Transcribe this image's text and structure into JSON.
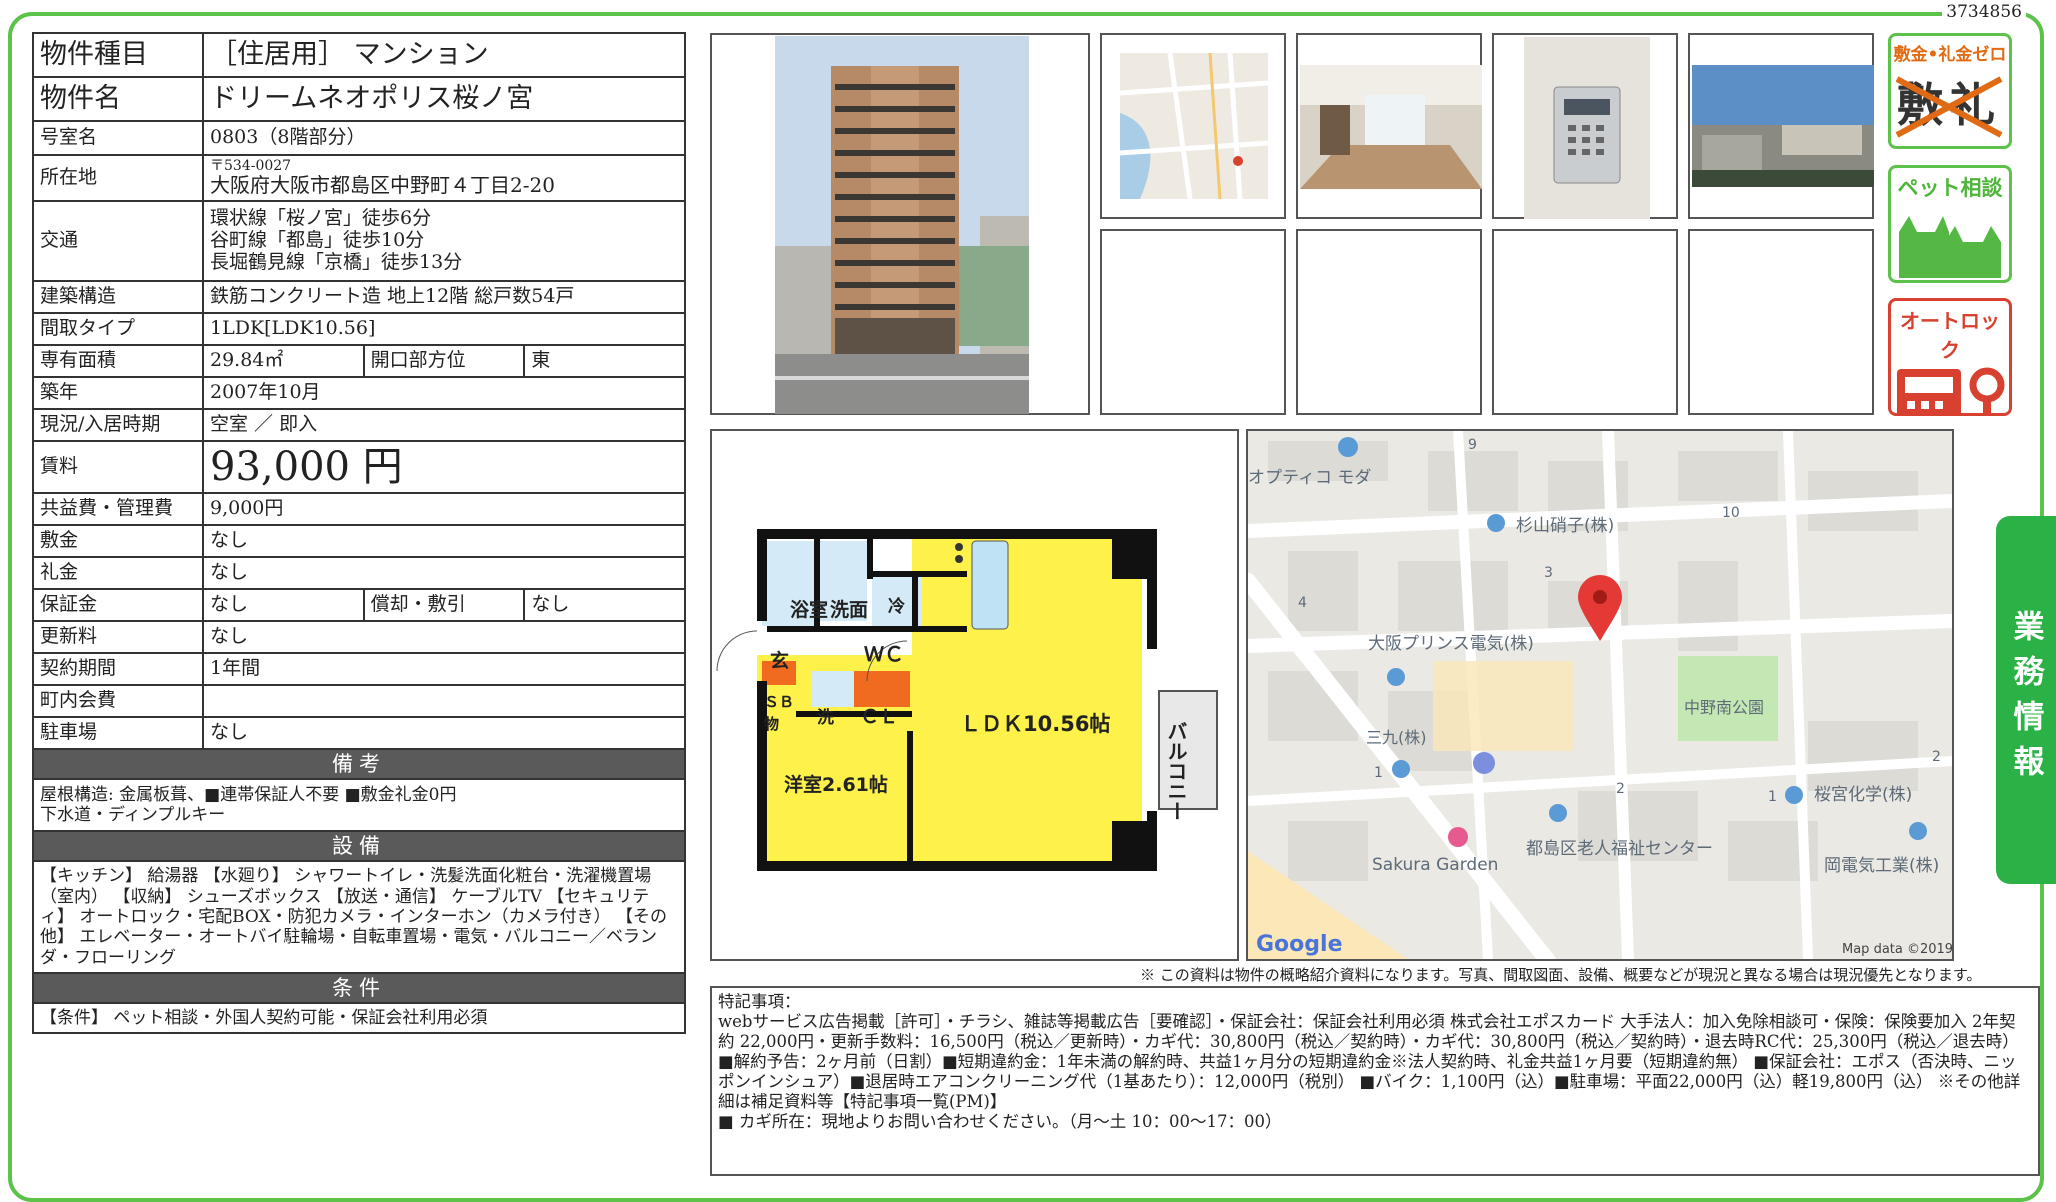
{
  "doc_id": "3734856",
  "rows": {
    "type": {
      "label": "物件種目",
      "value": "［住居用］ マンション"
    },
    "name": {
      "label": "物件名",
      "value": "ドリームネオポリス桜ノ宮"
    },
    "room": {
      "label": "号室名",
      "value": "0803（8階部分）"
    },
    "address": {
      "label": "所在地",
      "postal": "〒534-0027",
      "value": "大阪府大阪市都島区中野町４丁目2-20"
    },
    "transport": {
      "label": "交通",
      "lines": [
        "環状線「桜ノ宮」徒歩6分",
        "谷町線「都島」徒歩10分",
        "長堀鶴見線「京橋」徒歩13分"
      ]
    },
    "structure": {
      "label": "建築構造",
      "value": "鉄筋コンクリート造 地上12階 総戸数54戸"
    },
    "layout": {
      "label": "間取タイプ",
      "value": "1LDK[LDK10.56]"
    },
    "area": {
      "label": "専有面積",
      "value": "29.84㎡",
      "dir_label": "開口部方位",
      "dir_value": "東"
    },
    "built": {
      "label": "築年",
      "value": "2007年10月"
    },
    "status": {
      "label": "現況/入居時期",
      "value": "空室 ／ 即入"
    },
    "rent": {
      "label": "賃料",
      "value": "93,000 円"
    },
    "mgmt": {
      "label": "共益費・管理費",
      "value": "9,000円"
    },
    "deposit": {
      "label": "敷金",
      "value": "なし"
    },
    "key_money": {
      "label": "礼金",
      "value": "なし"
    },
    "guarantee": {
      "label": "保証金",
      "value": "なし",
      "amort_label": "償却・敷引",
      "amort_value": "なし"
    },
    "renewal": {
      "label": "更新料",
      "value": "なし"
    },
    "contract": {
      "label": "契約期間",
      "value": "1年間"
    },
    "town_fee": {
      "label": "町内会費",
      "value": ""
    },
    "parking": {
      "label": "駐車場",
      "value": "なし"
    }
  },
  "sections": {
    "notes": {
      "title": "備考",
      "lines": [
        "屋根構造: 金属板葺、■連帯保証人不要 ■敷金礼金0円",
        "下水道・ディンプルキー"
      ]
    },
    "equipment": {
      "title": "設備",
      "text": "【キッチン】 給湯器 【水廻り】 シャワートイレ・洗髪洗面化粧台・洗濯機置場（室内） 【収納】 シューズボックス 【放送・通信】 ケーブルTV 【セキュリティ】 オートロック・宅配BOX・防犯カメラ・インターホン（カメラ付き） 【その他】 エレベーター・オートバイ駐輪場・自転車置場・電気・バルコニー／ベランダ・フローリング"
    },
    "conditions": {
      "title": "条件",
      "text": "【条件】 ペット相談・外国人契約可能・保証会社利用必須"
    }
  },
  "badges": {
    "zero": "敷金•礼金ゼロ",
    "pet": "ペット相談",
    "autolock": "オートロック"
  },
  "side_tab": "業務情報",
  "floorplan": {
    "bath": "浴室",
    "wash": "洗面",
    "wc": "ＷＣ",
    "fridge": "冷",
    "entry": "玄",
    "sb": "ＳＢ",
    "storage": "物",
    "laundry": "洗",
    "cl": "ＣＬ",
    "ldk": "ＬＤＫ10.56帖",
    "western": "洋室2.61帖",
    "balcony": "バルコニー"
  },
  "map": {
    "labels": {
      "optico": "オプティコ モダ",
      "sugiyama": "杉山硝子(株)",
      "osaka_prince": "大阪プリンス電気(株)",
      "nakano_park": "中野南公園",
      "sanku": "三九(株)",
      "sakuramiya": "桜宮化学(株)",
      "fukushi": "都島区老人福祉センター",
      "sakura_garden": "Sakura Garden",
      "oka": "岡電気工業(株)",
      "n9": "9",
      "n10": "10",
      "n3": "3",
      "n4": "4",
      "n1a": "1",
      "n2a": "2",
      "n1b": "1",
      "n2b": "2"
    },
    "google": "Google",
    "attribution": "Map data ©2019"
  },
  "disclaimer": "※ この資料は物件の概略紹介資料になります。写真、間取図面、設備、概要などが現況と異なる場合は現況優先となります。",
  "remarks": {
    "title": "特記事項：",
    "lines": [
      "webサービス広告掲載［許可］・チラシ、雑誌等掲載広告［要確認］・保証会社：保証会社利用必須 株式会社エポスカード 大手法人：加入免除相談可・保険：保険要加入 2年契約 22,000円・更新手数料：16,500円（税込／更新時）・カギ代：30,800円（税込／契約時）・カギ代：30,800円（税込／契約時）・退去時RC代：25,300円（税込／退去時）",
      "■解約予告：2ヶ月前（日割）■短期違約金：1年未満の解約時、共益1ヶ月分の短期違約金※法人契約時、礼金共益1ヶ月要（短期違約無） ■保証会社：エポス（否決時、ニッポンインシュア）■退居時エアコンクリーニング代（1基あたり）：12,000円（税別） ■バイク：1,100円（込）■駐車場：平面22,000円（込）軽19,800円（込） ※その他詳細は補足資料等【特記事項一覧(PM)】",
      "■ カギ所在：現地よりお問い合わせください。（月～土 10：00～17：00）"
    ]
  }
}
